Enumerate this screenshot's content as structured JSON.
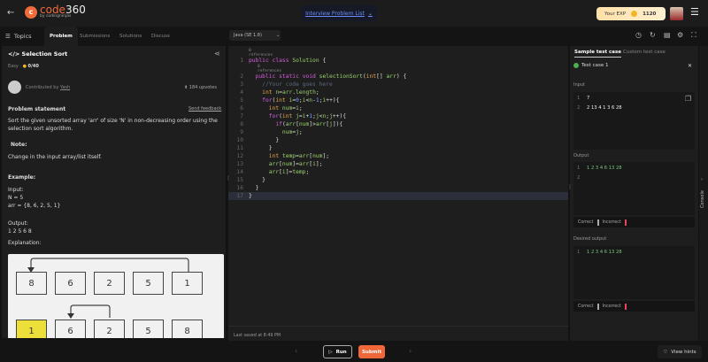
{
  "header": {
    "logo_main": "code",
    "logo_num": "360",
    "logo_sub": "by codingninjas",
    "problem_list": "Interview Problem List",
    "exp_label": "Your EXP",
    "exp_value": "1120"
  },
  "tabs": {
    "topics": "Topics",
    "items": [
      "Problem",
      "Submissions",
      "Solutions",
      "Discuss"
    ]
  },
  "language": "Java (SE 1.8)",
  "problem": {
    "title": "Selection Sort",
    "difficulty": "Easy",
    "score": "0/40",
    "contributed_by": "Contributed by",
    "author": "Yash",
    "upvotes": "184 upvotes",
    "statement_heading": "Problem statement",
    "feedback": "Send feedback",
    "statement": [
      "Sort the given unsorted array 'arr' of size 'N' in non-decreasing order using the",
      "selection sort algorithm."
    ],
    "note_heading": "Note:",
    "note": "Change in the input array/list itself.",
    "example_heading": "Example:",
    "input_label": "Input:",
    "input_lines": [
      "N = 5",
      "arr = {8, 6, 2, 5, 1}"
    ],
    "output_label": "Output:",
    "output": "1 2 5 6 8",
    "explanation_label": "Explanation:",
    "diagram": {
      "row1": [
        "8",
        "6",
        "2",
        "5",
        "1"
      ],
      "row2": [
        "1",
        "6",
        "2",
        "5",
        "8"
      ]
    }
  },
  "editor": {
    "references": "0 references",
    "lines": [
      "public class Solution {",
      "    public static void selectionSort(int[] arr) {",
      "        //Your code goes here",
      "        int n=arr.length;",
      "        for(int i=0;i<n-1;i++){",
      "            int num=i;",
      "            for(int j=i+1;j<n;j++){",
      "                if(arr[num]>arr[j]){",
      "                    num=j;",
      "                }",
      "            }",
      "            int temp=arr[num];",
      "            arr[num]=arr[i];",
      "            arr[i]=temp;",
      "        }",
      "    }",
      "}"
    ],
    "last_saved": "Last saved at 8:49 PM"
  },
  "testpanel": {
    "tabs": [
      "Sample test case",
      "Custom test case"
    ],
    "test_case": "Test case 1",
    "input_label": "Input",
    "input_lines": [
      "7",
      "2 13 4 1 3 6 28"
    ],
    "output_label": "Output",
    "output_lines": [
      "1 2 3 4 6 13 28",
      ""
    ],
    "desired_label": "Desired output",
    "desired_lines": [
      "1 2 3 4 6 13 28"
    ],
    "correct": "Correct",
    "incorrect": "Incorrect",
    "console": "Console"
  },
  "footer": {
    "run": "Run",
    "submit": "Submit",
    "hints": "View hints"
  },
  "colors": {
    "accent": "#f0673a",
    "success": "#4caf50",
    "incorrect": "#e8445a"
  }
}
